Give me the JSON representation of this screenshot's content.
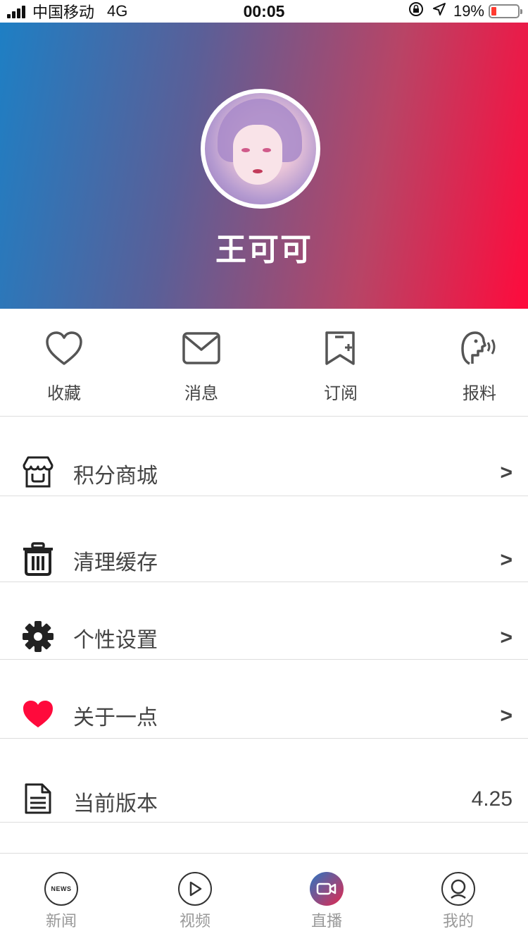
{
  "status_bar": {
    "carrier": "中国移动",
    "network": "4G",
    "time": "00:05",
    "battery": "19%",
    "battery_level_percent": 19
  },
  "profile": {
    "name": "王可可"
  },
  "quick_actions": [
    {
      "label": "收藏",
      "icon": "heart-outline-icon"
    },
    {
      "label": "消息",
      "icon": "envelope-icon"
    },
    {
      "label": "订阅",
      "icon": "bookmark-plus-icon"
    },
    {
      "label": "报料",
      "icon": "speaking-head-icon"
    }
  ],
  "menu": [
    {
      "label": "积分商城",
      "icon": "shop-icon",
      "trailing": ">"
    },
    {
      "label": "清理缓存",
      "icon": "trash-icon",
      "trailing": ">"
    },
    {
      "label": "个性设置",
      "icon": "gear-icon",
      "trailing": ">"
    },
    {
      "label": "关于一点",
      "icon": "heart-filled-icon",
      "trailing": ">",
      "icon_color": "#ff0a3c"
    },
    {
      "label": "当前版本",
      "icon": "document-icon",
      "value": "4.25"
    }
  ],
  "tabbar": [
    {
      "label": "新闻",
      "icon_text": "NEWS",
      "icon": "news-icon",
      "active": false
    },
    {
      "label": "视频",
      "icon": "play-icon",
      "active": false
    },
    {
      "label": "直播",
      "icon": "video-camera-icon",
      "active": false
    },
    {
      "label": "我的",
      "icon": "user-icon",
      "active": true
    }
  ],
  "colors": {
    "gradient_start": "#1e7fc4",
    "gradient_end": "#ff0a3c",
    "accent_red": "#ff0a3c",
    "text": "#444444",
    "divider": "#dddddd"
  }
}
